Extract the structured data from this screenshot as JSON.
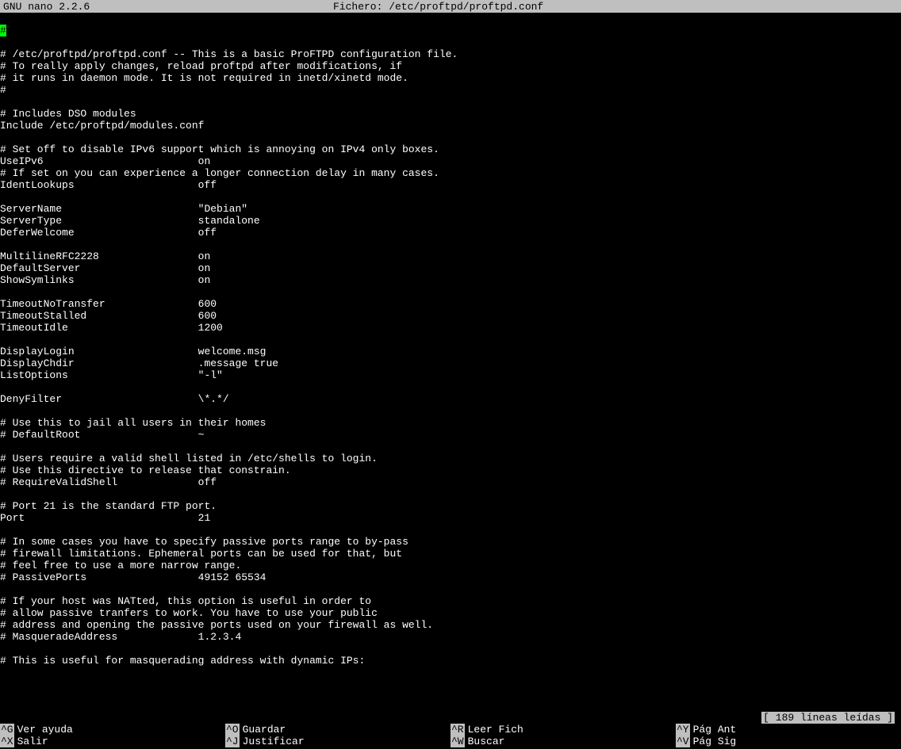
{
  "titlebar": {
    "app": "  GNU nano 2.2.6",
    "file_label": "Fichero: /etc/proftpd/proftpd.conf"
  },
  "cursor_char": "#",
  "lines": [
    "",
    "# /etc/proftpd/proftpd.conf -- This is a basic ProFTPD configuration file.",
    "# To really apply changes, reload proftpd after modifications, if",
    "# it runs in daemon mode. It is not required in inetd/xinetd mode.",
    "#",
    "",
    "# Includes DSO modules",
    "Include /etc/proftpd/modules.conf",
    "",
    "# Set off to disable IPv6 support which is annoying on IPv4 only boxes.",
    "UseIPv6                         on",
    "# If set on you can experience a longer connection delay in many cases.",
    "IdentLookups                    off",
    "",
    "ServerName                      \"Debian\"",
    "ServerType                      standalone",
    "DeferWelcome                    off",
    "",
    "MultilineRFC2228                on",
    "DefaultServer                   on",
    "ShowSymlinks                    on",
    "",
    "TimeoutNoTransfer               600",
    "TimeoutStalled                  600",
    "TimeoutIdle                     1200",
    "",
    "DisplayLogin                    welcome.msg",
    "DisplayChdir                    .message true",
    "ListOptions                     \"-l\"",
    "",
    "DenyFilter                      \\*.*/",
    "",
    "# Use this to jail all users in their homes",
    "# DefaultRoot                   ~",
    "",
    "# Users require a valid shell listed in /etc/shells to login.",
    "# Use this directive to release that constrain.",
    "# RequireValidShell             off",
    "",
    "# Port 21 is the standard FTP port.",
    "Port                            21",
    "",
    "# In some cases you have to specify passive ports range to by-pass",
    "# firewall limitations. Ephemeral ports can be used for that, but",
    "# feel free to use a more narrow range.",
    "# PassivePorts                  49152 65534",
    "",
    "# If your host was NATted, this option is useful in order to",
    "# allow passive tranfers to work. You have to use your public",
    "# address and opening the passive ports used on your firewall as well.",
    "# MasqueradeAddress             1.2.3.4",
    "",
    "# This is useful for masquerading address with dynamic IPs:"
  ],
  "status_message": "[ 189 líneas leídas ]",
  "shortcuts": [
    {
      "key": "^G",
      "label": "Ver ayuda"
    },
    {
      "key": "^O",
      "label": "Guardar"
    },
    {
      "key": "^R",
      "label": "Leer Fich"
    },
    {
      "key": "^Y",
      "label": "Pág Ant"
    },
    {
      "key": "^X",
      "label": "Salir"
    },
    {
      "key": "^J",
      "label": "Justificar"
    },
    {
      "key": "^W",
      "label": "Buscar"
    },
    {
      "key": "^V",
      "label": "Pág Sig"
    }
  ]
}
